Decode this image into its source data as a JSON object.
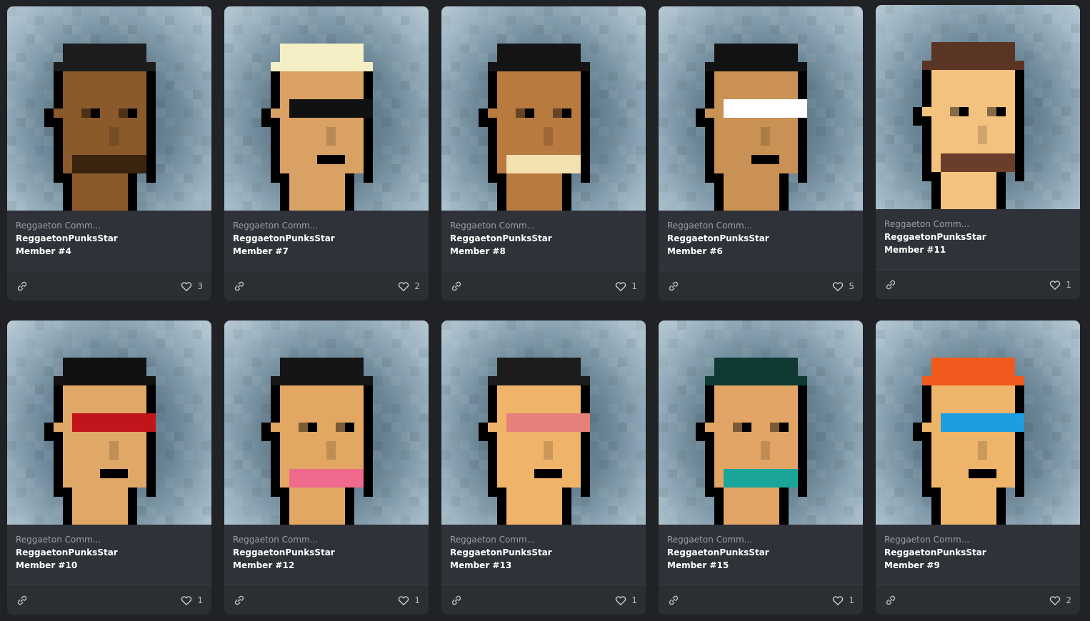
{
  "cards": [
    {
      "collection": "Reggaeton Comm...",
      "name": "ReggaetonPunksStar",
      "member": "Member #4",
      "likes": "3",
      "skin": "#8a5a2b",
      "hat": "#1c1c1c",
      "accent": "#3a2410"
    },
    {
      "collection": "Reggaeton Comm...",
      "name": "ReggaetonPunksStar",
      "member": "Member #7",
      "likes": "2",
      "skin": "#d9a164",
      "hat": "#f5efc6",
      "accent": "#111111"
    },
    {
      "collection": "Reggaeton Comm...",
      "name": "ReggaetonPunksStar",
      "member": "Member #8",
      "likes": "1",
      "skin": "#b97a40",
      "hat": "#141414",
      "accent": "#f3e1b0"
    },
    {
      "collection": "Reggaeton Comm...",
      "name": "ReggaetonPunksStar",
      "member": "Member #6",
      "likes": "5",
      "skin": "#c99254",
      "hat": "#121212",
      "accent": "#ffffff"
    },
    {
      "collection": "Reggaeton Comm...",
      "name": "ReggaetonPunksStar",
      "member": "Member #11",
      "likes": "1",
      "skin": "#f3c27f",
      "hat": "#5a3524",
      "accent": "#6b3e2a"
    },
    {
      "collection": "Reggaeton Comm...",
      "name": "ReggaetonPunksStar",
      "member": "Member #10",
      "likes": "1",
      "skin": "#e0a867",
      "hat": "#111111",
      "accent": "#c0151b"
    },
    {
      "collection": "Reggaeton Comm...",
      "name": "ReggaetonPunksStar",
      "member": "Member #12",
      "likes": "1",
      "skin": "#e1a763",
      "hat": "#151515",
      "accent": "#ef6a8c"
    },
    {
      "collection": "Reggaeton Comm...",
      "name": "ReggaetonPunksStar",
      "member": "Member #13",
      "likes": "1",
      "skin": "#f0b36a",
      "hat": "#1c1c1c",
      "accent": "#e5817a"
    },
    {
      "collection": "Reggaeton Comm...",
      "name": "ReggaetonPunksStar",
      "member": "Member #15",
      "likes": "1",
      "skin": "#e2a565",
      "hat": "#0e3a33",
      "accent": "#1aa59a"
    },
    {
      "collection": "Reggaeton Comm...",
      "name": "ReggaetonPunksStar",
      "member": "Member #9",
      "likes": "2",
      "skin": "#eeb56a",
      "hat": "#f05a1c",
      "accent": "#1b9fe0"
    }
  ],
  "icons": {
    "link": "link-icon",
    "like": "heart-icon"
  }
}
